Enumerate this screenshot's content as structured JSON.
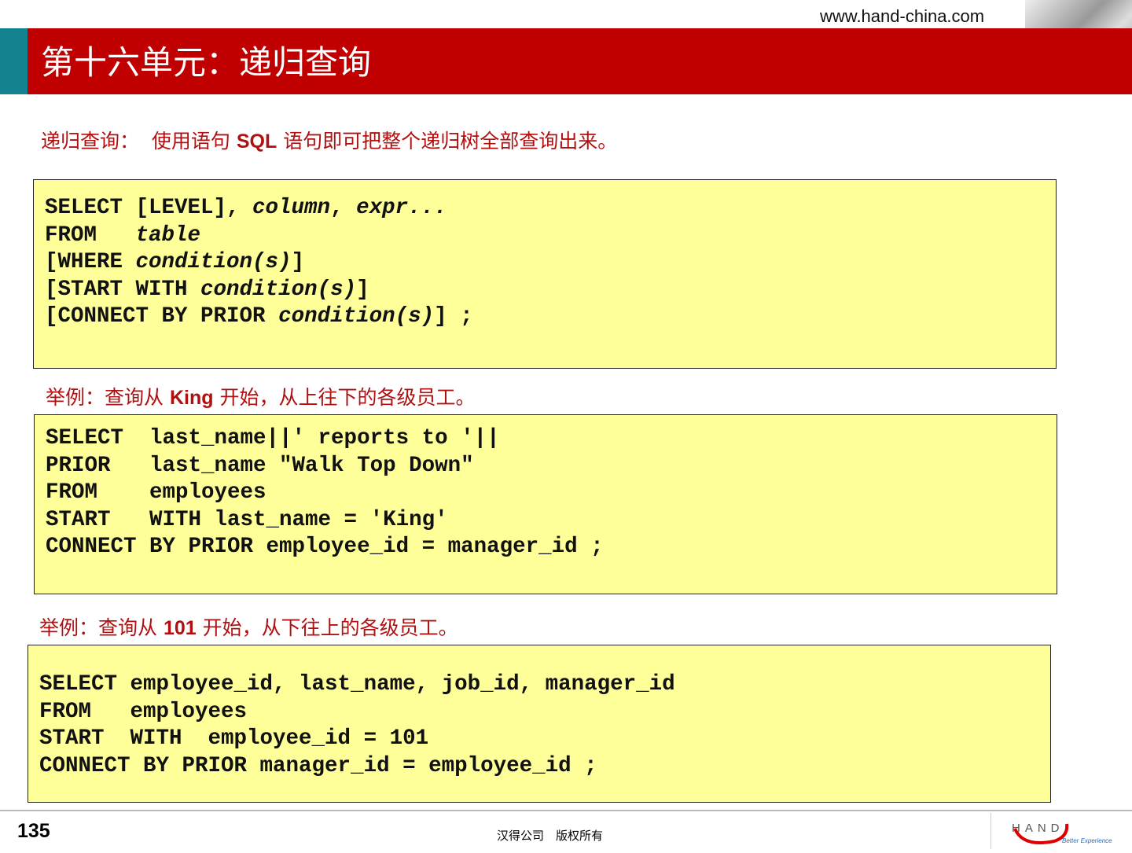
{
  "header": {
    "url": "www.hand-china.com",
    "title": "第十六单元：递归查询"
  },
  "intro": {
    "label": "递归查询：",
    "text_pre": "使用语句 ",
    "sql": "SQL",
    "text_post": " 语句即可把整个递归树全部查询出来。"
  },
  "syntax": [
    [
      {
        "t": "SELECT [LEVEL], "
      },
      {
        "t": "column",
        "i": 1
      },
      {
        "t": ", "
      },
      {
        "t": "expr...",
        "i": 1
      }
    ],
    [
      {
        "t": "FROM   "
      },
      {
        "t": "table",
        "i": 1
      }
    ],
    [
      {
        "t": "[WHERE "
      },
      {
        "t": "condition(s)",
        "i": 1
      },
      {
        "t": "]"
      }
    ],
    [
      {
        "t": "[START WITH "
      },
      {
        "t": "condition(s)",
        "i": 1
      },
      {
        "t": "]"
      }
    ],
    [
      {
        "t": "[CONNECT BY PRIOR "
      },
      {
        "t": "condition(s)",
        "i": 1
      },
      {
        "t": "] ;"
      }
    ]
  ],
  "example1": {
    "pre": "举例：查询从 ",
    "key": "King",
    "post": " 开始，从上往下的各级员工。"
  },
  "code1": [
    [
      {
        "t": "SELECT  last_name||' reports to '||"
      }
    ],
    [
      {
        "t": "PRIOR   last_name \"Walk Top Down\""
      }
    ],
    [
      {
        "t": "FROM    employees"
      }
    ],
    [
      {
        "t": "START   WITH last_name = 'King'"
      }
    ],
    [
      {
        "t": "CONNECT BY PRIOR employee_id = manager_id ;"
      }
    ]
  ],
  "example2": {
    "pre": "举例：查询从 ",
    "key": "101",
    "post": " 开始，从下往上的各级员工。"
  },
  "code2": [
    [
      {
        "t": "SELECT employee_id, last_name, job_id, manager_id"
      }
    ],
    [
      {
        "t": "FROM   employees"
      }
    ],
    [
      {
        "t": "START  WITH  employee_id = 101"
      }
    ],
    [
      {
        "t": "CONNECT BY PRIOR manager_id = employee_id ;"
      }
    ]
  ],
  "footer": {
    "page": "135",
    "copyright": "汉得公司　版权所有",
    "logo_text": "HAND",
    "logo_tagline": "Better Experience"
  }
}
